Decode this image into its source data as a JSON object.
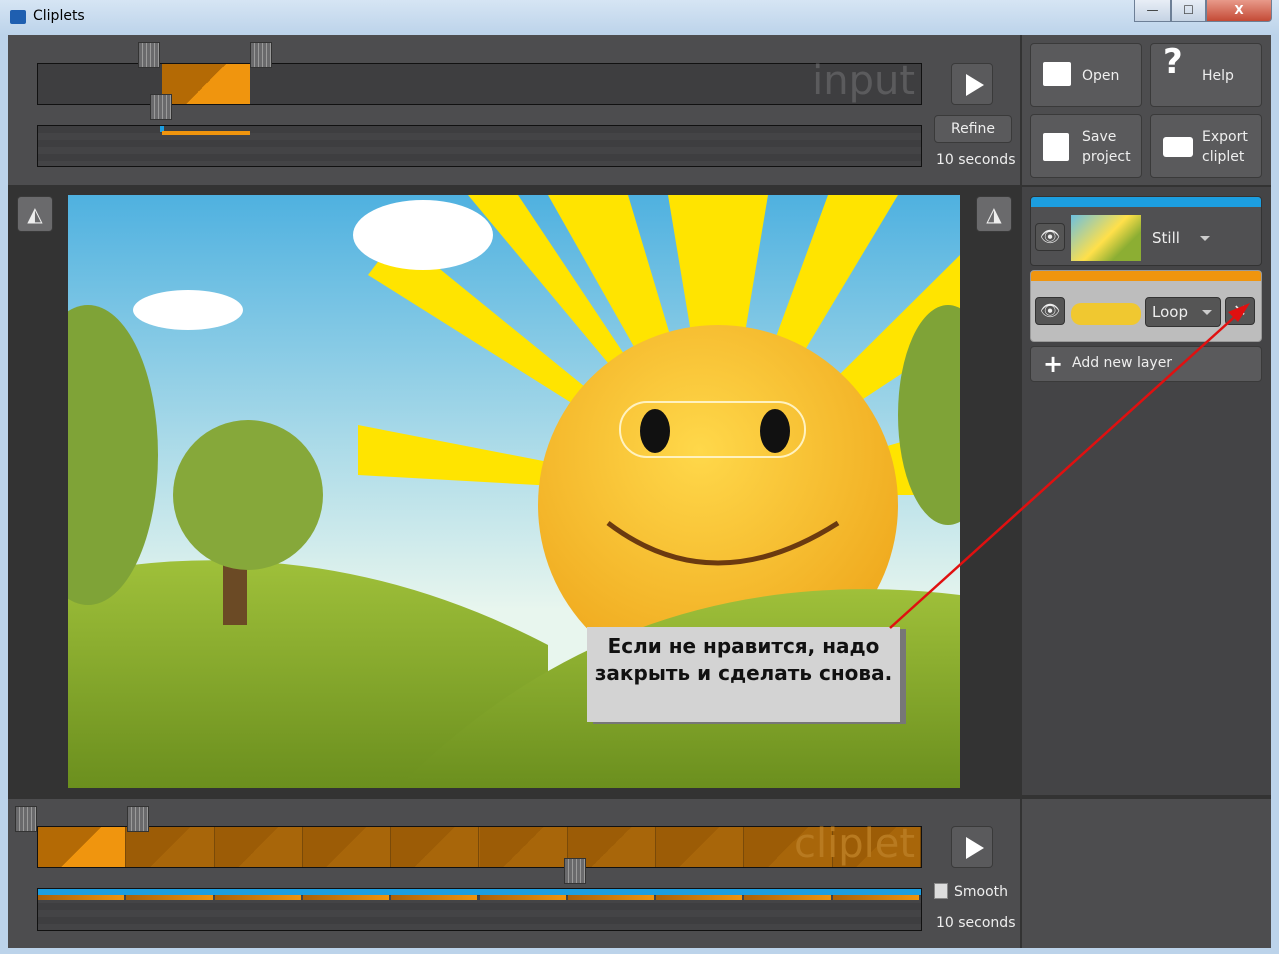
{
  "window": {
    "title": "Cliplets",
    "minimize": "—",
    "maximize": "☐",
    "close": "X"
  },
  "input_timeline": {
    "watermark": "input",
    "refine_label": "Refine",
    "duration": "10 seconds",
    "selection_start": 0.14,
    "selection_end": 0.24
  },
  "toolbar": {
    "open": "Open",
    "help": "Help",
    "save": "Save project",
    "export": "Export cliplet"
  },
  "layers": [
    {
      "mode": "Still",
      "color": "#1c9ee0"
    },
    {
      "mode": "Loop",
      "color": "#f0950e"
    }
  ],
  "add_layer": "Add new layer",
  "output_timeline": {
    "watermark": "cliplet",
    "smooth_label": "Smooth",
    "smooth_checked": false,
    "duration": "10 seconds",
    "segments": 10,
    "playhead": 0.61
  },
  "annotation": {
    "text": "Если не нравится, надо закрыть и сделать снова.",
    "arrow_color": "#e01010"
  },
  "colors": {
    "accent_orange": "#f0950e",
    "accent_blue": "#1c9ee0",
    "panel": "#4d4d4f"
  }
}
